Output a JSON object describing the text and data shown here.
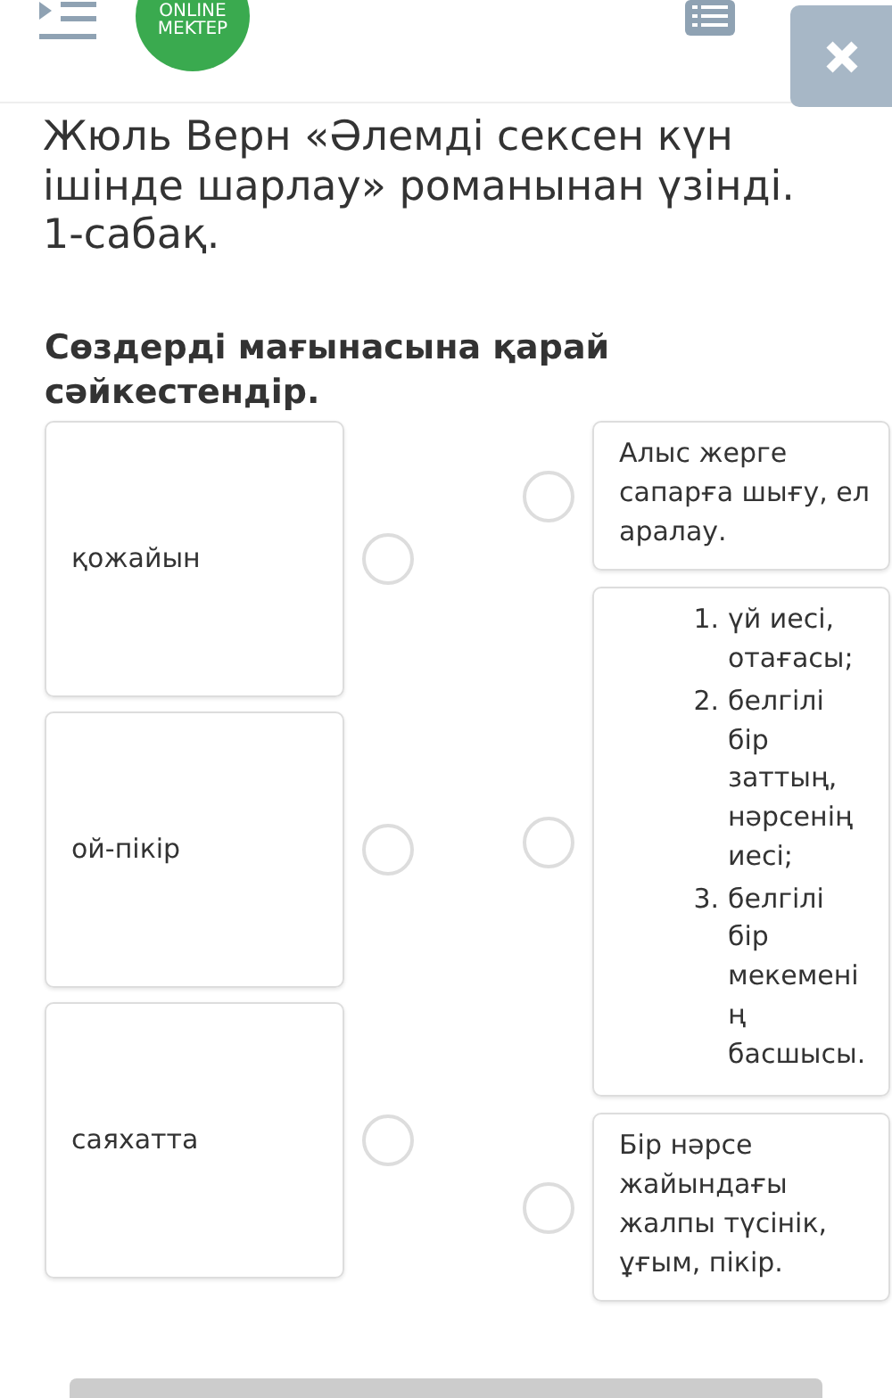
{
  "header": {
    "logo_lines": [
      "ONLINE",
      "MEKTEP"
    ]
  },
  "title": "Жюль Верн «Әлемді сексен күн ішінде шарлау» романынан үзінді. 1-сабақ.",
  "instruction": "Сөздерді мағынасына қарай сәйкестендір.",
  "left_items": [
    {
      "text": "қожайын"
    },
    {
      "text": "ой-пікір"
    },
    {
      "text": "саяхатта"
    }
  ],
  "right_items": [
    {
      "kind": "text",
      "text": "Алыс жерге сапарға шығу, ел аралау."
    },
    {
      "kind": "list",
      "items": [
        {
          "marker": "1.",
          "text": "үй иесі, отағасы;"
        },
        {
          "marker": "2.",
          "text": "белгілі бір заттың, нәрсенің иесі;"
        },
        {
          "marker": "3.",
          "text": "белгілі бір мекемені ң басшысы."
        }
      ]
    },
    {
      "kind": "text",
      "text": "Бір нәрсе жайындағы жалпы түсінік, ұғым, пікір."
    }
  ]
}
